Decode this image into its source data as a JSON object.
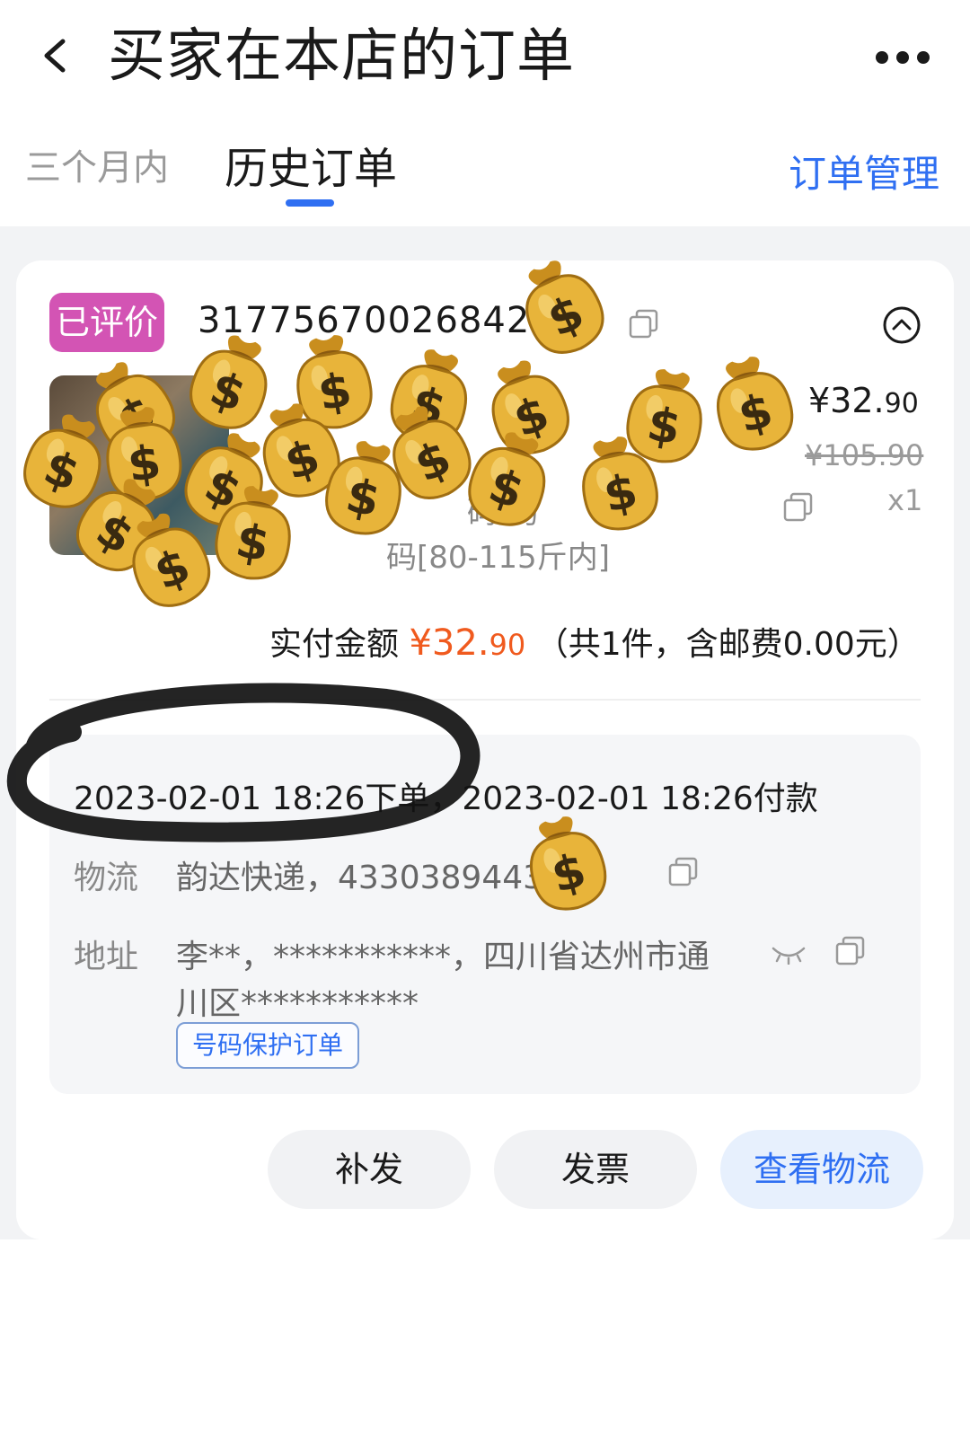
{
  "header": {
    "back_icon": "chevron-left-icon",
    "title": "买家在本店的订单",
    "more_icon": "more-dots-icon"
  },
  "tabs": {
    "items": [
      {
        "label": "三个月内",
        "active": false
      },
      {
        "label": "历史订单",
        "active": true
      }
    ],
    "order_manage": "订单管理"
  },
  "order": {
    "status_badge": "已评价",
    "order_number_visible": "31775670026842",
    "product": {
      "price_int": "¥32.",
      "price_dec": "90",
      "original_price": "¥105.90",
      "quantity": "x1",
      "title_visible": "",
      "subtitle_visible": "…",
      "spec_line1": "码:均",
      "spec_line2": "码[80-115斤内]"
    },
    "paid": {
      "label": "实付金额",
      "amount_int": "¥32.",
      "amount_dec": "90",
      "suffix": "（共1件，含邮费0.00元）"
    },
    "times": {
      "text": "2023-02-01 18:26下单，2023-02-01 18:26付款"
    },
    "logistics": {
      "label": "物流",
      "value_visible": "韵达快递，4330389443"
    },
    "address": {
      "label": "地址",
      "line1": "李**，***********，四川省达州市通",
      "line2": "川区***********",
      "protect_badge": "号码保护订单"
    },
    "actions": {
      "reissue": "补发",
      "invoice": "发票",
      "view_logistics": "查看物流"
    }
  },
  "colors": {
    "accent_blue": "#2f6ff2",
    "badge_pink": "#d354b4",
    "price_orange": "#f05a1e",
    "page_bg": "#f2f3f5"
  }
}
